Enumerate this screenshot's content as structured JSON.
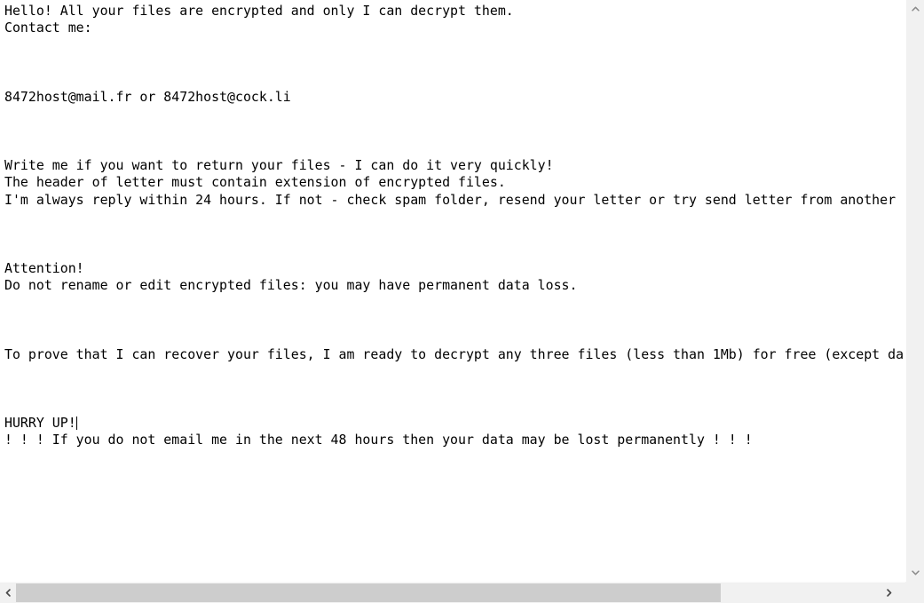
{
  "document": {
    "lines": [
      "Hello! All your files are encrypted and only I can decrypt them.",
      "Contact me:",
      "",
      "",
      "",
      "8472host@mail.fr or 8472host@cock.li",
      "",
      "",
      "",
      "Write me if you want to return your files - I can do it very quickly!",
      "The header of letter must contain extension of encrypted files.",
      "I'm always reply within 24 hours. If not - check spam folder, resend your letter or try send letter from another",
      "",
      "",
      "",
      "Attention!",
      "Do not rename or edit encrypted files: you may have permanent data loss.",
      "",
      "",
      "",
      "To prove that I can recover your files, I am ready to decrypt any three files (less than 1Mb) for free (except da",
      "",
      "",
      "",
      "HURRY UP!",
      "! ! ! If you do not email me in the next 48 hours then your data may be lost permanently ! ! !"
    ],
    "caret_line_index": 24
  },
  "scrollbars": {
    "vertical": {
      "up_icon": "chevron-up-icon",
      "down_icon": "chevron-down-icon"
    },
    "horizontal": {
      "left_icon": "chevron-left-icon",
      "right_icon": "chevron-right-icon"
    },
    "colors": {
      "track": "#f1f1f1",
      "thumb": "#cdcdcd",
      "arrow": "#8a8a8a"
    }
  },
  "page": {
    "background": "#ffffff",
    "text_color": "#000000"
  }
}
